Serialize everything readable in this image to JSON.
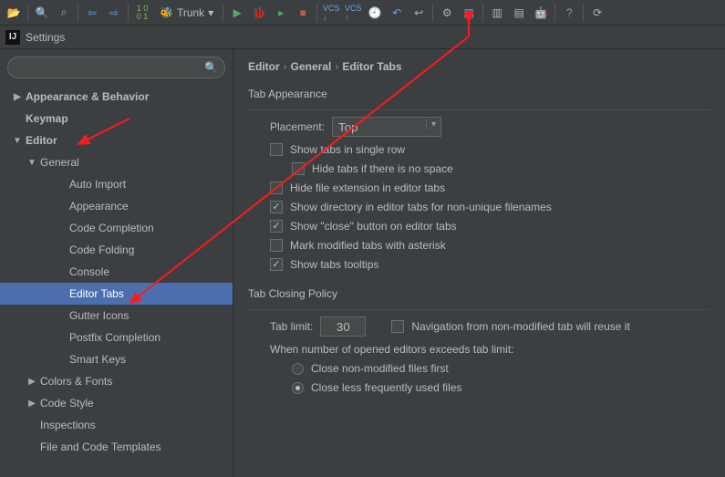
{
  "window": {
    "title": "Settings"
  },
  "toolbar": {
    "trunk_label": "Trunk"
  },
  "breadcrumb": {
    "a": "Editor",
    "b": "General",
    "c": "Editor Tabs"
  },
  "sidebar": {
    "items": [
      {
        "label": "Appearance & Behavior",
        "expand": "▶",
        "bold": true
      },
      {
        "label": "Keymap",
        "expand": "",
        "bold": true
      },
      {
        "label": "Editor",
        "expand": "▼",
        "bold": true
      },
      {
        "label": "General",
        "expand": "▼",
        "lvl": 1
      },
      {
        "label": "Auto Import",
        "lvl": 2
      },
      {
        "label": "Appearance",
        "lvl": 2
      },
      {
        "label": "Code Completion",
        "lvl": 2
      },
      {
        "label": "Code Folding",
        "lvl": 2
      },
      {
        "label": "Console",
        "lvl": 2
      },
      {
        "label": "Editor Tabs",
        "lvl": 2,
        "selected": true
      },
      {
        "label": "Gutter Icons",
        "lvl": 2
      },
      {
        "label": "Postfix Completion",
        "lvl": 2
      },
      {
        "label": "Smart Keys",
        "lvl": 2
      },
      {
        "label": "Colors & Fonts",
        "expand": "▶",
        "lvl": 1
      },
      {
        "label": "Code Style",
        "expand": "▶",
        "lvl": 1
      },
      {
        "label": "Inspections",
        "lvl": 1
      },
      {
        "label": "File and Code Templates",
        "lvl": 1
      }
    ]
  },
  "tab_appearance": {
    "title": "Tab Appearance",
    "placement_label": "Placement:",
    "placement_value": "Top",
    "single_row": "Show tabs in single row",
    "hide_no_space": "Hide tabs if there is no space",
    "hide_ext": "Hide file extension in editor tabs",
    "show_dir": "Show directory in editor tabs for non-unique filenames",
    "show_close": "Show \"close\" button on editor tabs",
    "mark_modified": "Mark modified tabs with asterisk",
    "show_tooltips": "Show tabs tooltips"
  },
  "closing": {
    "title": "Tab Closing Policy",
    "limit_label": "Tab limit:",
    "limit_value": "30",
    "nav_reuse": "Navigation from non-modified tab will reuse it",
    "exceeds": "When number of opened editors exceeds tab limit:",
    "close_nonmod": "Close non-modified files first",
    "close_less": "Close less frequently used files"
  }
}
